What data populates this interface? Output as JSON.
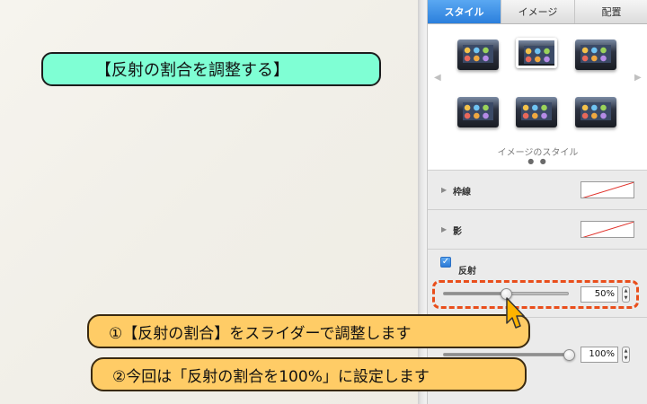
{
  "canvas": {
    "title_label": "【反射の割合を調整する】"
  },
  "inspector": {
    "tabs": [
      {
        "label": "スタイル",
        "active": true
      },
      {
        "label": "イメージ",
        "active": false
      },
      {
        "label": "配置",
        "active": false
      }
    ],
    "image_styles": {
      "caption": "イメージのスタイル",
      "page_dots": "● ●",
      "prev_icon": "◀",
      "next_icon": "▶"
    },
    "border": {
      "label": "枠線",
      "disclosure_icon": "▶"
    },
    "shadow": {
      "label": "影",
      "disclosure_icon": "▶"
    },
    "reflection": {
      "label": "反射",
      "checked": true,
      "checkmark": "✓",
      "value_text": "50%",
      "value": 0.5
    },
    "opacity": {
      "value_text": "100%",
      "value": 1.0
    }
  },
  "callouts": {
    "step1": "①【反射の割合】をスライダーで調整します",
    "step2": "②今回は「反射の割合を100%」に設定します"
  },
  "colors": {
    "title_pill": "#7fffd4",
    "callout": "#ffcc66",
    "highlight": "#e94e1b",
    "active_tab": "#2b7fdc"
  }
}
